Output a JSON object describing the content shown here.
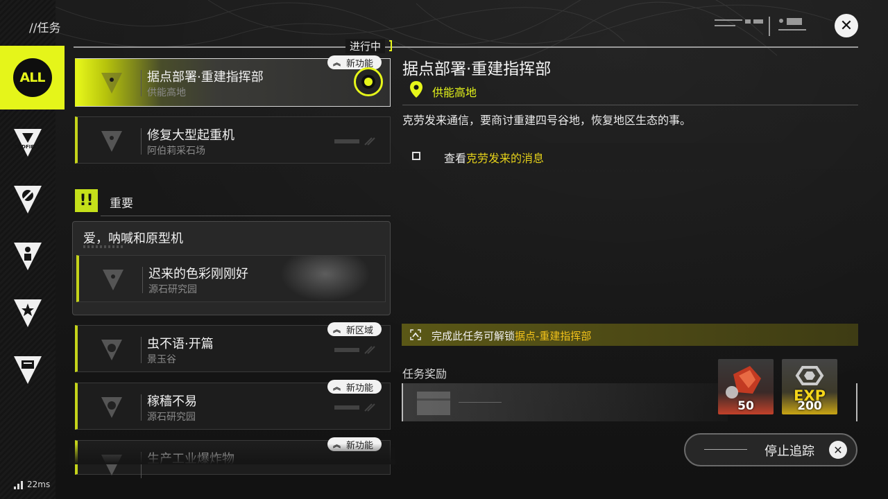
{
  "header": {
    "title": "//任务",
    "close_icon": "close-icon"
  },
  "rail": {
    "all_label": "ALL",
    "items": [
      {
        "icon": "endfield-icon",
        "label": "ENDFIELD"
      },
      {
        "icon": "vortex-icon"
      },
      {
        "icon": "person-icon"
      },
      {
        "icon": "star-icon"
      },
      {
        "icon": "box-icon"
      }
    ]
  },
  "list": {
    "in_progress_label": "进行中",
    "quests": [
      {
        "name": "据点部署·重建指挥部",
        "location": "供能高地",
        "badge": "新功能"
      },
      {
        "name": "修复大型起重机",
        "location": "阿伯莉采石场"
      },
      {
        "name": "虫不语·开篇",
        "location": "景玉谷",
        "badge": "新区域"
      },
      {
        "name": "稼穑不易",
        "location": "源石研究园",
        "badge": "新功能"
      },
      {
        "name": "生产工业爆炸物",
        "badge": "新功能"
      }
    ],
    "important": {
      "icon_text": "!!",
      "label": "重要",
      "group_title": "爱，呐喊和原型机",
      "quest": {
        "name": "迟来的色彩刚刚好",
        "location": "源石研究园"
      }
    }
  },
  "detail": {
    "title": "据点部署·重建指挥部",
    "location": "供能高地",
    "description": "克劳发来通信，要商讨重建四号谷地，恢复地区生态的事。",
    "objective": {
      "prefix": "查看",
      "highlight": "克劳发来的消息"
    },
    "unlock": {
      "prefix": "完成此任务可解锁",
      "highlight": "据点-重建指挥部"
    },
    "rewards_label": "任务奖励",
    "rewards": [
      {
        "icon": "red-crystal-icon",
        "qty": "50"
      },
      {
        "icon": "exp-icon",
        "label": "EXP",
        "qty": "200"
      }
    ],
    "stop_tracking": "停止追踪"
  },
  "status": {
    "ping": "22ms"
  },
  "colors": {
    "accent": "#e5f51a",
    "highlight": "#e5d11a",
    "unlock_highlight": "#f2c21a"
  }
}
